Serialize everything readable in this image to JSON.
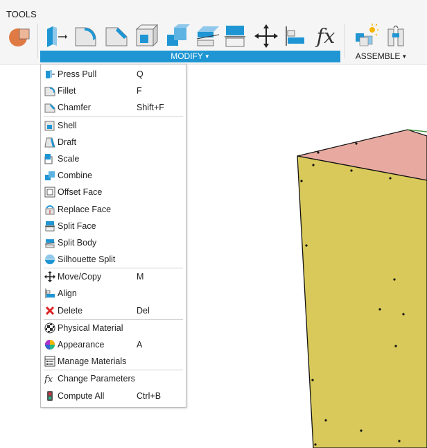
{
  "toolbar": {
    "tools_label": "TOOLS",
    "modify_label": "MODIFY",
    "assemble_label": "ASSEMBLE",
    "fx_label": "fx",
    "accent_color": "#1f96d3",
    "icons": [
      "create-sketch-icon",
      "press-pull-icon",
      "fillet-icon",
      "chamfer-icon",
      "shell-icon",
      "combine-icon",
      "split-body-icon",
      "split-face-icon",
      "move-copy-icon",
      "align-icon",
      "change-parameters-icon",
      "new-component-icon",
      "joint-icon"
    ]
  },
  "menu": {
    "groups": [
      [
        {
          "label": "Press Pull",
          "shortcut": "Q",
          "icon": "press-pull-icon"
        },
        {
          "label": "Fillet",
          "shortcut": "F",
          "icon": "fillet-icon"
        },
        {
          "label": "Chamfer",
          "shortcut": "Shift+F",
          "icon": "chamfer-icon"
        }
      ],
      [
        {
          "label": "Shell",
          "shortcut": "",
          "icon": "shell-icon"
        },
        {
          "label": "Draft",
          "shortcut": "",
          "icon": "draft-icon"
        },
        {
          "label": "Scale",
          "shortcut": "",
          "icon": "scale-icon"
        },
        {
          "label": "Combine",
          "shortcut": "",
          "icon": "combine-icon"
        },
        {
          "label": "Offset Face",
          "shortcut": "",
          "icon": "offset-face-icon"
        },
        {
          "label": "Replace Face",
          "shortcut": "",
          "icon": "replace-face-icon"
        },
        {
          "label": "Split Face",
          "shortcut": "",
          "icon": "split-face-icon"
        },
        {
          "label": "Split Body",
          "shortcut": "",
          "icon": "split-body-icon"
        },
        {
          "label": "Silhouette Split",
          "shortcut": "",
          "icon": "silhouette-split-icon"
        }
      ],
      [
        {
          "label": "Move/Copy",
          "shortcut": "M",
          "icon": "move-copy-icon"
        },
        {
          "label": "Align",
          "shortcut": "",
          "icon": "align-icon"
        },
        {
          "label": "Delete",
          "shortcut": "Del",
          "icon": "delete-icon"
        }
      ],
      [
        {
          "label": "Physical Material",
          "shortcut": "",
          "icon": "physical-material-icon"
        },
        {
          "label": "Appearance",
          "shortcut": "A",
          "icon": "appearance-icon"
        },
        {
          "label": "Manage Materials",
          "shortcut": "",
          "icon": "manage-materials-icon"
        }
      ],
      [
        {
          "label": "Change Parameters",
          "shortcut": "",
          "icon": "change-parameters-icon"
        },
        {
          "label": "Compute All",
          "shortcut": "Ctrl+B",
          "icon": "compute-all-icon"
        }
      ]
    ]
  },
  "viewport": {
    "body_colors": {
      "front": "#d8c95a",
      "top": "#e8aaa0",
      "edge": "#111111"
    }
  }
}
